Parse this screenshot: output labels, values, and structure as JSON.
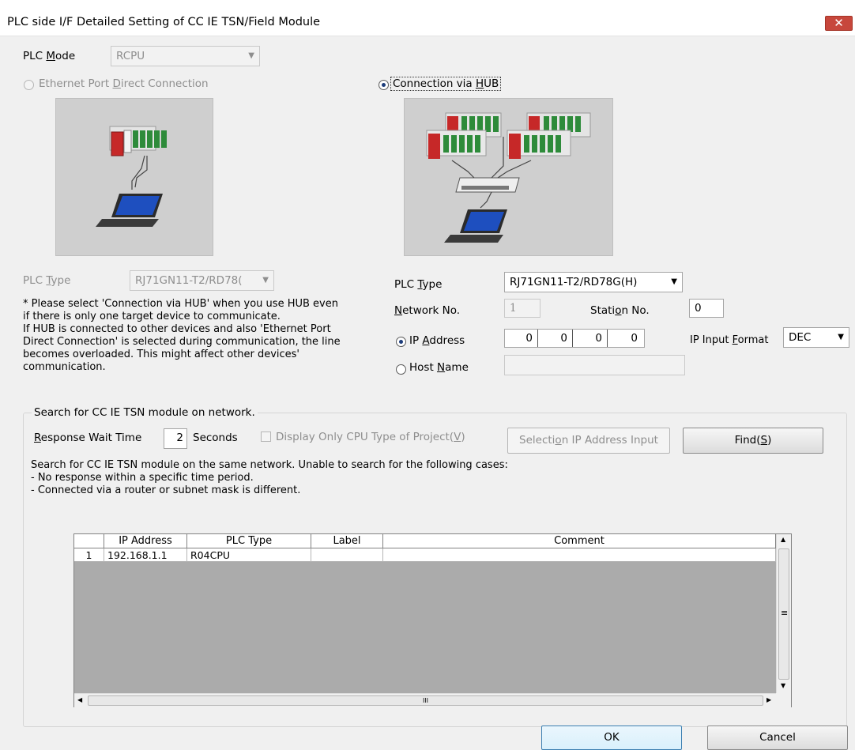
{
  "window": {
    "title": "PLC side I/F Detailed Setting of CC IE TSN/Field Module",
    "close_glyph": "✕"
  },
  "plc_mode": {
    "label_prefix": "PLC ",
    "label_mnemonic": "M",
    "label_suffix": "ode",
    "value": "RCPU"
  },
  "direct": {
    "label_prefix": "Ethernet Port ",
    "label_mnemonic": "D",
    "label_suffix": "irect Connection",
    "selected": false
  },
  "hub": {
    "label_prefix": "Connection via ",
    "label_mnemonic": "H",
    "label_suffix": "UB",
    "selected": true
  },
  "left_plc_type": {
    "label_prefix": "PLC ",
    "label_mnemonic": "T",
    "label_suffix": "ype",
    "value": "RJ71GN11-T2/RD78("
  },
  "note": {
    "lines": [
      "* Please select 'Connection via HUB' when you use HUB even",
      "if there is only one target device to communicate.",
      "If HUB is connected to other devices and also 'Ethernet Port",
      "Direct Connection' is selected during communication, the line",
      "becomes overloaded. This might affect other devices'",
      "communication."
    ]
  },
  "right_plc_type": {
    "label_prefix": "PLC ",
    "label_mnemonic": "T",
    "label_suffix": "ype",
    "value": "RJ71GN11-T2/RD78G(H)"
  },
  "network": {
    "label_prefix": "",
    "label_mnemonic": "N",
    "label_suffix": "etwork No.",
    "value": "1"
  },
  "station": {
    "label_prefix": "Stati",
    "label_mnemonic": "o",
    "label_suffix": "n No.",
    "value": "0"
  },
  "ip_address": {
    "label_prefix": "IP ",
    "label_mnemonic": "A",
    "label_suffix": "ddress",
    "selected": true,
    "octets": [
      "0",
      "0",
      "0",
      "0"
    ]
  },
  "host_name": {
    "label_prefix": "Host ",
    "label_mnemonic": "N",
    "label_suffix": "ame",
    "selected": false,
    "value": ""
  },
  "ip_format": {
    "label_prefix": "IP Input ",
    "label_mnemonic": "F",
    "label_suffix": "ormat",
    "value": "DEC"
  },
  "search": {
    "group_title": "Search for CC IE TSN module on network.",
    "wait_label_mnemonic": "R",
    "wait_label_suffix": "esponse Wait Time",
    "wait_value": "2",
    "seconds_label": "Seconds",
    "display_only_label": "Display Only CPU Type of Project(",
    "display_only_mnemonic": "V",
    "display_only_suffix": ")",
    "selection_btn_prefix": "Selecti",
    "selection_btn_mnemonic": "o",
    "selection_btn_suffix": "n IP Address Input",
    "find_btn_prefix": "Find(",
    "find_btn_mnemonic": "S",
    "find_btn_suffix": ")",
    "desc_lines": [
      "Search for CC IE TSN module on the same network. Unable to search for the following cases:",
      "- No response within a specific time period.",
      "- Connected via a router or subnet mask is different."
    ]
  },
  "results": {
    "columns": [
      "IP Address",
      "PLC Type",
      "Label",
      "Comment"
    ],
    "rows": [
      {
        "no": "1",
        "ip": "192.168.1.1",
        "plc_type": "R04CPU",
        "label": "",
        "comment": ""
      }
    ],
    "hscroll_glyph": "III",
    "vscroll_glyph": "≡"
  },
  "buttons": {
    "ok": "OK",
    "cancel": "Cancel"
  },
  "colors": {
    "accent": "#1c3c7a",
    "close": "#c7473c",
    "grid_bg": "#ababab"
  },
  "icons": [
    "close-icon",
    "dropdown-arrow-icon",
    "radio-icon",
    "plc-rack-icon",
    "laptop-icon",
    "hub-icon",
    "scroll-arrow-icon"
  ]
}
